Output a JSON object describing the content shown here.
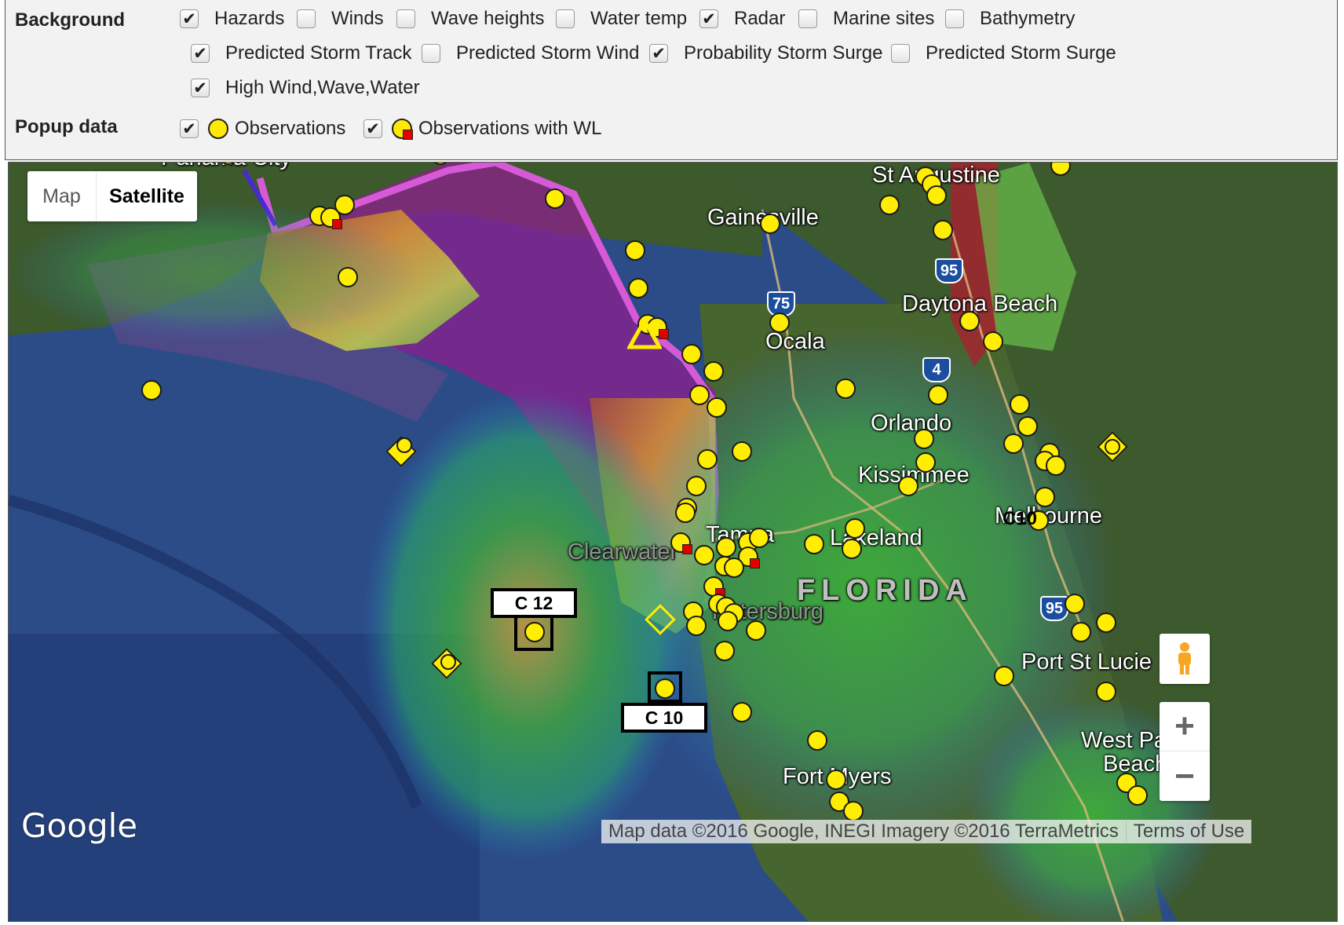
{
  "controls": {
    "background_label": "Background",
    "popup_label": "Popup data",
    "background_options": [
      {
        "label": "Hazards",
        "checked": true
      },
      {
        "label": "Winds",
        "checked": false
      },
      {
        "label": "Wave heights",
        "checked": false
      },
      {
        "label": "Water temp",
        "checked": false
      },
      {
        "label": "Radar",
        "checked": true
      },
      {
        "label": "Marine sites",
        "checked": false
      },
      {
        "label": "Bathymetry",
        "checked": false
      },
      {
        "label": "Predicted Storm Track",
        "checked": true
      },
      {
        "label": "Predicted Storm Wind",
        "checked": false
      },
      {
        "label": "Probability Storm Surge",
        "checked": true
      },
      {
        "label": "Predicted Storm Surge",
        "checked": false
      },
      {
        "label": "High Wind,Wave,Water",
        "checked": true
      }
    ],
    "popup_options": [
      {
        "label": "Observations",
        "checked": true,
        "icon": "yellow-circle"
      },
      {
        "label": "Observations with WL",
        "checked": true,
        "icon": "yellow-circle-red-square"
      }
    ]
  },
  "map": {
    "type_toggle": {
      "map_label": "Map",
      "satellite_label": "Satellite",
      "selected": "Satellite"
    },
    "places": [
      "Panama City",
      "St Augustine",
      "Gainesville",
      "Daytona Beach",
      "Ocala",
      "Orlando",
      "Kissimmee",
      "Melbourne",
      "Tampa",
      "Lakeland",
      "Clearwater",
      "St Petersburg",
      "FLORIDA",
      "Port St Lucie",
      "West Palm Beach",
      "Fort Myers"
    ],
    "place_labels": {
      "panama": "Panama City",
      "staug": "St Augustine",
      "gaines": "Gainesville",
      "daytona": "Daytona Beach",
      "ocala": "Ocala",
      "orlando": "Orlando",
      "kissimmee": "Kissimmee",
      "melbourne": "Melbourne",
      "tampa": "Tampa",
      "lakeland": "Lakeland",
      "clearwater": "Clearwater",
      "stpete": "Petersburg",
      "florida": "FLORIDA",
      "portstlucie": "Port St Lucie",
      "westpalm1": "West Palm",
      "westpalm2": "Beach",
      "fortmyers": "Fort Myers"
    },
    "highway_shields": {
      "i75": "75",
      "i95a": "95",
      "i4": "4",
      "i95b": "95"
    },
    "buoy_tags": {
      "c12": "C 12",
      "c10": "C 10",
      "c10_inland": "C10"
    },
    "google_logo": "Google",
    "attribution": "Map data ©2016 Google, INEGI Imagery ©2016 TerraMetrics",
    "terms": "Terms of Use",
    "zoom_in": "+",
    "zoom_out": "−",
    "colors": {
      "observation": "#ffee00",
      "water_level_flag": "#e00000",
      "storm_track": "#cc33cc",
      "hazard_zone": "#8c1a8c",
      "ocean": "#2d4f8a",
      "land": "#3d5a2e"
    }
  }
}
